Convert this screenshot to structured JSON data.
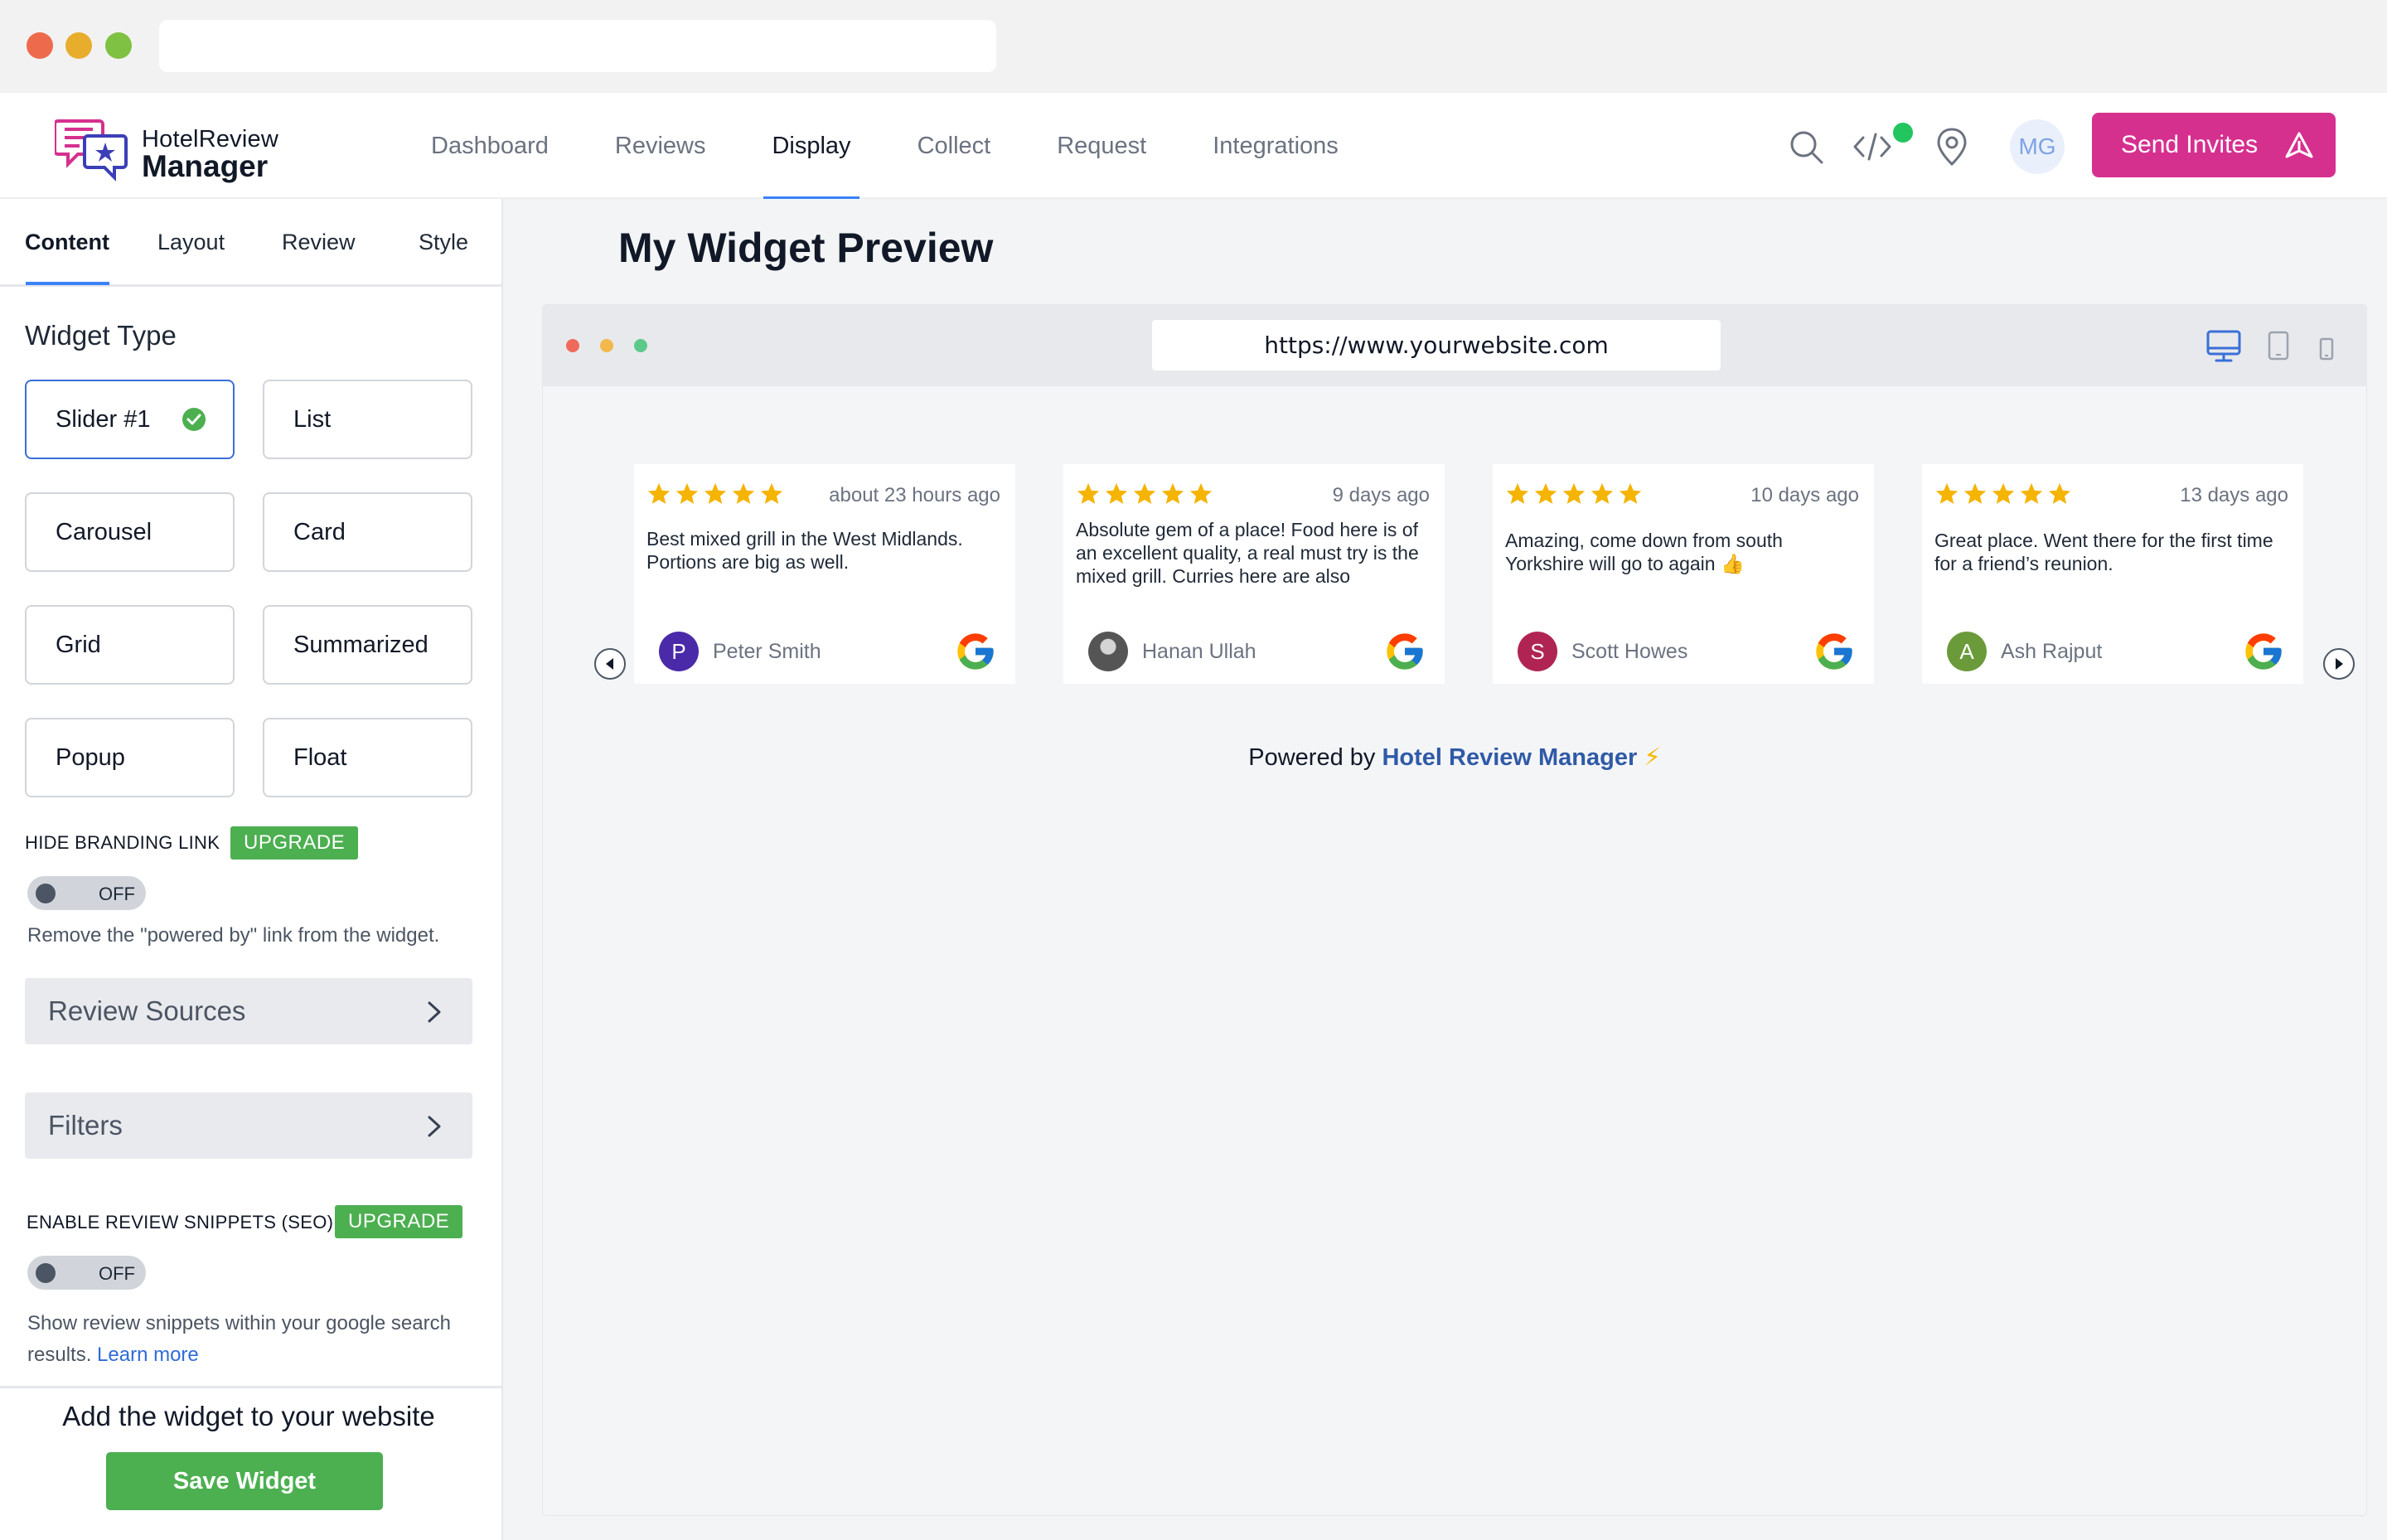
{
  "app": {
    "logo_line1": "HotelReview",
    "logo_line2": "Manager"
  },
  "nav": {
    "items": [
      {
        "label": "Dashboard",
        "active": false
      },
      {
        "label": "Reviews",
        "active": false
      },
      {
        "label": "Display",
        "active": true
      },
      {
        "label": "Collect",
        "active": false
      },
      {
        "label": "Request",
        "active": false
      },
      {
        "label": "Integrations",
        "active": false
      }
    ]
  },
  "header": {
    "icons": [
      "search-icon",
      "code-icon",
      "location-pin-icon"
    ],
    "notification_dot_color": "#22c55e",
    "avatar_initials": "MG",
    "send_invites_label": "Send Invites",
    "brand_color": "#d6308f"
  },
  "sidebar": {
    "tabs": [
      {
        "label": "Content",
        "active": true
      },
      {
        "label": "Layout",
        "active": false
      },
      {
        "label": "Review",
        "active": false
      },
      {
        "label": "Style",
        "active": false
      }
    ],
    "widget_type_title": "Widget Type",
    "widget_types": [
      {
        "label": "Slider #1",
        "selected": true
      },
      {
        "label": "List",
        "selected": false
      },
      {
        "label": "Carousel",
        "selected": false
      },
      {
        "label": "Card",
        "selected": false
      },
      {
        "label": "Grid",
        "selected": false
      },
      {
        "label": "Summarized",
        "selected": false
      },
      {
        "label": "Popup",
        "selected": false
      },
      {
        "label": "Float",
        "selected": false
      }
    ],
    "hide_branding": {
      "label": "HIDE BRANDING LINK",
      "badge": "UPGRADE",
      "toggle_label": "OFF",
      "help": "Remove the \"powered by\" link from the widget."
    },
    "accordions": [
      {
        "label": "Review Sources"
      },
      {
        "label": "Filters"
      }
    ],
    "snippets": {
      "label": "ENABLE REVIEW SNIPPETS (SEO)",
      "badge": "UPGRADE",
      "toggle_label": "OFF",
      "help": "Show review snippets within your google search results.",
      "learn_more": "Learn more"
    },
    "add_widget_text": "Add the widget to your website",
    "save_label": "Save Widget"
  },
  "preview": {
    "title": "My Widget Preview",
    "url": "https://www.yourwebsite.com",
    "device_icons": [
      "desktop-icon",
      "tablet-icon",
      "mobile-icon"
    ],
    "reviews": [
      {
        "rating": 5,
        "time": "about 23 hours ago",
        "text": "Best mixed grill in the West Midlands. Portions are big as well.",
        "author": "Peter Smith",
        "initial": "P",
        "avatar_color": "#4a2aa8",
        "source": "google-icon"
      },
      {
        "rating": 5,
        "time": "9 days ago",
        "text": "Absolute gem of a place! Food here is of an excellent quality, a real must try is the mixed grill. Curries here are also",
        "author": "Hanan Ullah",
        "initial": "",
        "avatar_color": "#777777",
        "source": "google-icon"
      },
      {
        "rating": 5,
        "time": "10 days ago",
        "text": "Amazing, come down from south Yorkshire will go to again 👍",
        "author": "Scott Howes",
        "initial": "S",
        "avatar_color": "#b02454",
        "source": "google-icon"
      },
      {
        "rating": 5,
        "time": "13 days ago",
        "text": "Great place. Went there for the first time for a friend’s reunion.",
        "author": "Ash Rajput",
        "initial": "A",
        "avatar_color": "#6b9a3a",
        "source": "google-icon"
      }
    ],
    "powered_by_prefix": "Powered by",
    "powered_by_brand": "Hotel Review Manager",
    "powered_by_bolt": "⚡",
    "star_color": "#f5b400"
  }
}
